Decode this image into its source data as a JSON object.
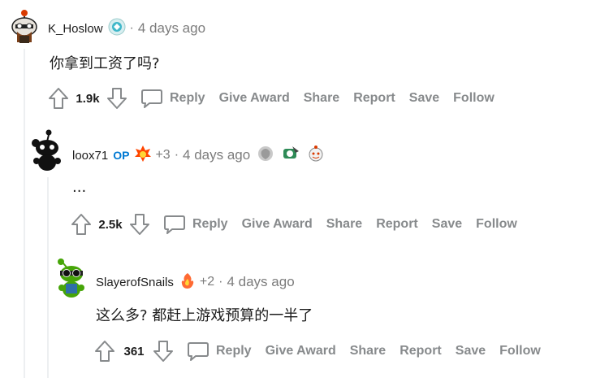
{
  "comments": [
    {
      "author": "K_Hoslow",
      "op_label": "",
      "award_count": "",
      "time": "4 days ago",
      "body": "你拿到工资了吗?",
      "score": "1.9k"
    },
    {
      "author": "loox71",
      "op_label": "OP",
      "award_count": "+3",
      "time": "4 days ago",
      "body": "...",
      "score": "2.5k"
    },
    {
      "author": "SlayerofSnails",
      "op_label": "",
      "award_count": "+2",
      "time": "4 days ago",
      "body": "这么多? 都赶上游戏预算的一半了",
      "score": "361"
    }
  ],
  "actions": {
    "reply": "Reply",
    "give_award": "Give Award",
    "share": "Share",
    "report": "Report",
    "save": "Save",
    "follow": "Follow"
  },
  "separator": "·",
  "icons": {
    "upvote": "upvote-arrow-icon",
    "downvote": "downvote-arrow-icon",
    "reply": "speech-bubble-icon",
    "flair": "snoo-flair-icon",
    "awards": [
      "flame-award-icon",
      "silver-award-icon",
      "helpful-award-icon",
      "wholesome-award-icon",
      "fire-award-icon"
    ]
  },
  "colors": {
    "op": "#0079d3",
    "muted": "#878a8c",
    "text": "#1c1c1c"
  }
}
